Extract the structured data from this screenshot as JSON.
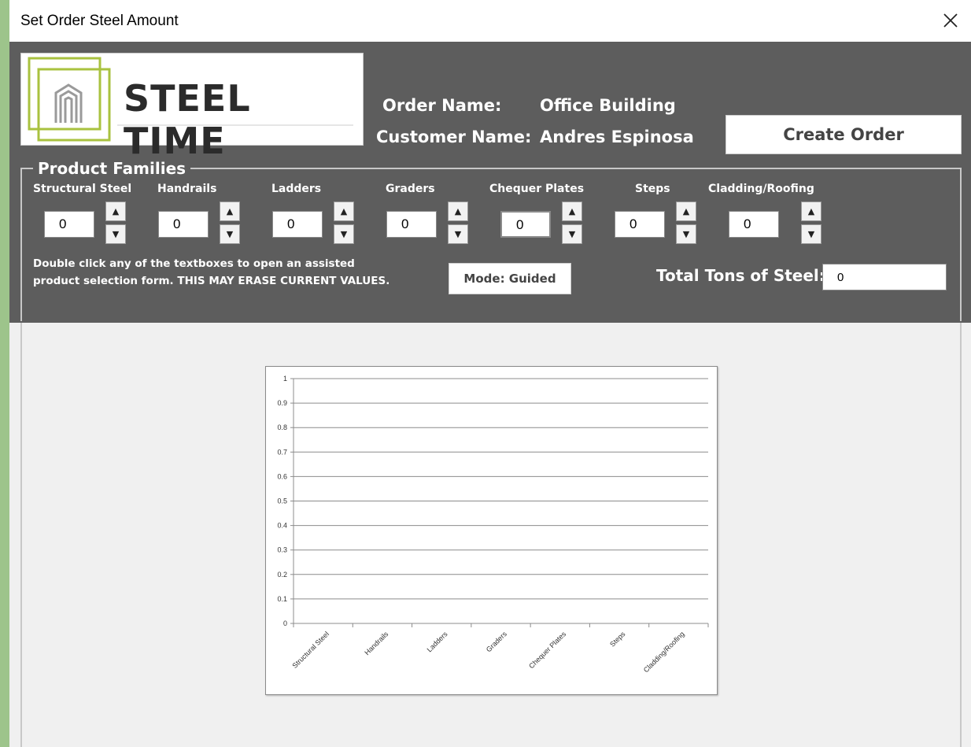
{
  "window": {
    "title": "Set Order Steel Amount"
  },
  "logo": {
    "brand": "STEEL TIME"
  },
  "order": {
    "order_name_label": "Order Name:",
    "order_name_value": "Office Building",
    "customer_name_label": "Customer Name:",
    "customer_name_value": "Andres Espinosa"
  },
  "buttons": {
    "create_order": "Create Order",
    "mode": "Mode: Guided"
  },
  "product_families": {
    "title": "Product Families",
    "items": [
      {
        "label": "Structural Steel",
        "value": "0"
      },
      {
        "label": "Handrails",
        "value": "0"
      },
      {
        "label": "Ladders",
        "value": "0"
      },
      {
        "label": "Graders",
        "value": "0"
      },
      {
        "label": "Chequer Plates",
        "value": "0"
      },
      {
        "label": "Steps",
        "value": "0"
      },
      {
        "label": "Cladding/Roofing",
        "value": "0"
      }
    ],
    "hint_line1": "Double click any of the textboxes to open an assisted",
    "hint_line2": "product selection form. THIS MAY ERASE CURRENT VALUES."
  },
  "total": {
    "label": "Total Tons of Steel:",
    "value": "0"
  },
  "icons": {
    "close": "close-icon",
    "spin_up": "arrow-up-icon",
    "spin_down": "arrow-down-icon",
    "logo_mark": "steel-building-logo-icon"
  },
  "colors": {
    "panel_dark": "#5d5d5d",
    "logo_accent": "#a9c23f",
    "desktop": "#9dc48b"
  },
  "chart_data": {
    "type": "bar",
    "categories": [
      "Structural Steel",
      "Handrails",
      "Ladders",
      "Graders",
      "Chequer Plates",
      "Steps",
      "Cladding/Roofing"
    ],
    "values": [
      0,
      0,
      0,
      0,
      0,
      0,
      0
    ],
    "ylim": [
      0,
      1
    ],
    "yticks": [
      "0",
      "0.1",
      "0.2",
      "0.3",
      "0.4",
      "0.5",
      "0.6",
      "0.7",
      "0.8",
      "0.9",
      "1"
    ],
    "grid": true,
    "legend": "none"
  }
}
